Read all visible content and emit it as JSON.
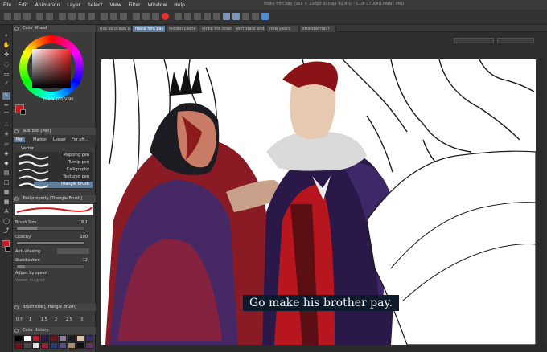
{
  "menu": [
    "File",
    "Edit",
    "Animation",
    "Layer",
    "Select",
    "View",
    "Filter",
    "Window",
    "Help"
  ],
  "window_title": "make him pay (535 × 330px 300dpi 42.8%) - CLIP STUDIO PAINT PRO",
  "tabs": [
    {
      "label": "rise as ocean o...",
      "active": false
    },
    {
      "label": "make him pay",
      "active": true
    },
    {
      "label": "hidden castle",
      "active": false
    },
    {
      "label": "strike me down...",
      "active": false
    },
    {
      "label": "wolf stare and...",
      "active": false
    },
    {
      "label": "new years",
      "active": false
    },
    {
      "label": "strawberries?",
      "active": false
    }
  ],
  "panels": {
    "color_wheel_title": "Color Wheel",
    "wheel_values": {
      "h": "H",
      "h_val": "0",
      "s": "S",
      "s_val": "100",
      "v": "V",
      "v_val": "96"
    },
    "sub_tool_title": "Sub Tool [Pen]",
    "sub_tool_tabs": [
      "Pen",
      "Marker",
      "Lesser",
      "For eff..."
    ],
    "vector_label": "Vector",
    "brushes": [
      "Mapping pen",
      "Turnip pen",
      "Calligraphy",
      "Textured pen",
      "Triangle Brush"
    ],
    "tool_property_title": "Tool property [Triangle Brush]",
    "properties": [
      {
        "label": "Brush Size",
        "value": "18.1"
      },
      {
        "label": "Opacity",
        "value": "100"
      },
      {
        "label": "Anti-aliasing",
        "value": ""
      },
      {
        "label": "Stabilization",
        "value": "12"
      },
      {
        "label": "Adjust by speed",
        "value": ""
      },
      {
        "label": "Vector magnet",
        "value": ""
      }
    ],
    "brush_size_title": "Brush size [Triangle Brush]",
    "brush_sizes": [
      "0.7",
      "1",
      "1.5",
      "2",
      "2.5",
      "3"
    ],
    "color_history_title": "Color History",
    "history_colors": [
      "#000000",
      "#ffffff",
      "#c0182b",
      "#2a1b4a",
      "#6e1520",
      "#8d7c9a",
      "#1b1b1b",
      "#d9c2a6",
      "#3d2a6a",
      "#7a0f18",
      "#4a4a4a",
      "#e1e1e1",
      "#94273a",
      "#2c3e78",
      "#5c4b86",
      "#aa8a6c",
      "#111111",
      "#663366"
    ]
  },
  "canvas": {
    "subtitle": "Go make his brother pay."
  },
  "colors": {
    "main": "#d3191c",
    "sub": "#000000",
    "accent": "#5e7ea0"
  }
}
